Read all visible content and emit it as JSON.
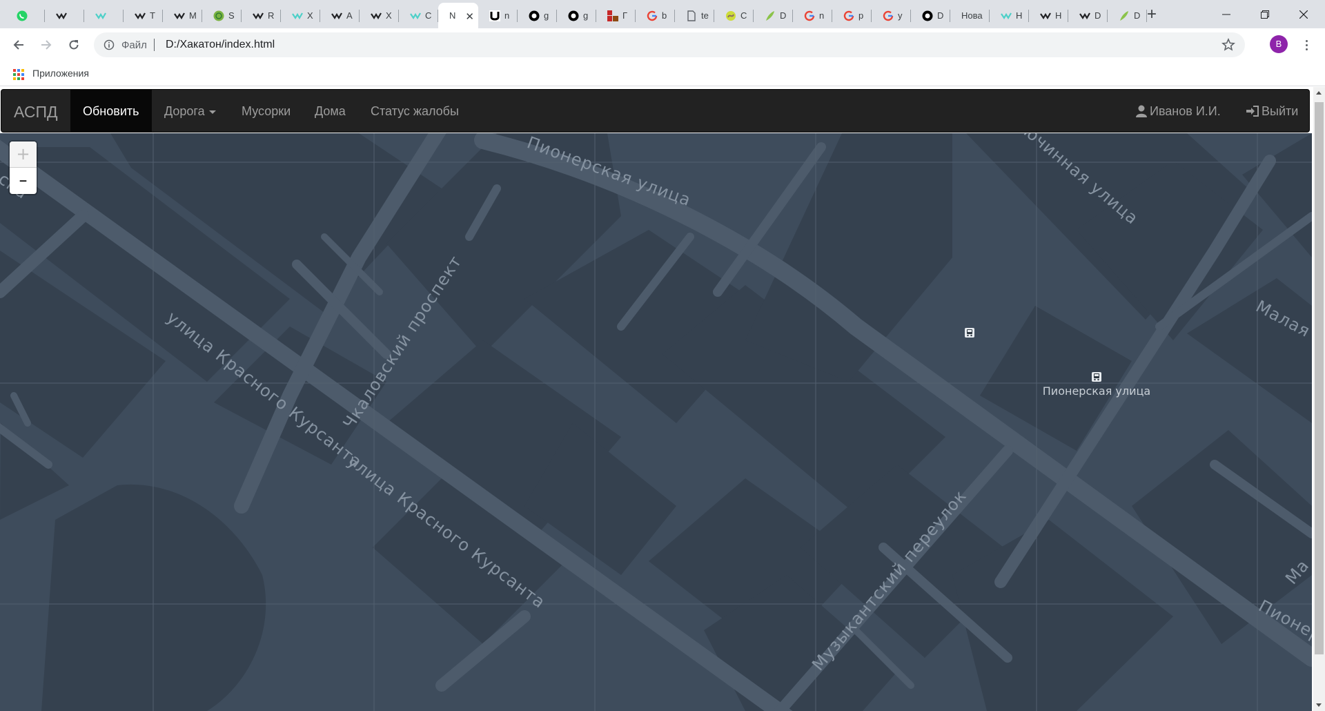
{
  "browser": {
    "tabs": [
      {
        "favicon": "whatsapp-icon",
        "title": "",
        "color": "#25d366"
      },
      {
        "favicon": "bird-logo-icon",
        "title": "",
        "color": "#202124"
      },
      {
        "favicon": "bird-logo-icon",
        "title": "",
        "color": "#4dd0c8"
      },
      {
        "favicon": "bird-logo-icon",
        "title": "T",
        "color": "#202124"
      },
      {
        "favicon": "bird-logo-icon",
        "title": "M",
        "color": "#202124"
      },
      {
        "favicon": "globe-icon",
        "title": "S",
        "color": "#7cb342"
      },
      {
        "favicon": "bird-logo-icon",
        "title": "R",
        "color": "#202124"
      },
      {
        "favicon": "bird-logo-icon",
        "title": "X",
        "color": "#4dd0c8"
      },
      {
        "favicon": "bird-logo-icon",
        "title": "A",
        "color": "#202124"
      },
      {
        "favicon": "bird-logo-icon",
        "title": "X",
        "color": "#202124"
      },
      {
        "favicon": "bird-logo-icon",
        "title": "C",
        "color": "#4dd0c8"
      },
      {
        "favicon": "",
        "title": "N",
        "color": "#202124",
        "active": true
      },
      {
        "favicon": "unity-icon",
        "title": "n",
        "color": "#000000"
      },
      {
        "favicon": "github-gist-icon",
        "title": "g",
        "color": "#000000"
      },
      {
        "favicon": "github-gist-icon",
        "title": "g",
        "color": "#000000"
      },
      {
        "favicon": "blocks-icon",
        "title": "Г",
        "color": "#c62828"
      },
      {
        "favicon": "google-icon",
        "title": "b",
        "color": "#4285f4"
      },
      {
        "favicon": "document-icon",
        "title": "te",
        "color": "#5f6368"
      },
      {
        "favicon": "snake-icon",
        "title": "C",
        "color": "#8d6e63"
      },
      {
        "favicon": "feather-icon",
        "title": "D",
        "color": "#8bc34a"
      },
      {
        "favicon": "google-icon",
        "title": "n",
        "color": "#4285f4"
      },
      {
        "favicon": "google-icon",
        "title": "p",
        "color": "#4285f4"
      },
      {
        "favicon": "google-icon",
        "title": "y",
        "color": "#4285f4"
      },
      {
        "favicon": "github-icon",
        "title": "D",
        "color": "#000000"
      },
      {
        "favicon": "",
        "title": "Нова",
        "color": "#202124"
      },
      {
        "favicon": "bird-logo-icon",
        "title": "H",
        "color": "#4dd0c8"
      },
      {
        "favicon": "bird-logo-icon",
        "title": "H",
        "color": "#202124"
      },
      {
        "favicon": "bird-logo-icon",
        "title": "D",
        "color": "#202124"
      },
      {
        "favicon": "feather-icon",
        "title": "D",
        "color": "#8bc34a"
      }
    ],
    "new_tab": "+",
    "address": {
      "scheme_label": "Файл",
      "url": "D:/Хакатон/index.html"
    },
    "profile_initial": "В",
    "bookmarks": {
      "apps_label": "Приложения"
    }
  },
  "navbar": {
    "brand": "АСПД",
    "items": [
      {
        "label": "Обновить",
        "active": true
      },
      {
        "label": "Дорога",
        "dropdown": true
      },
      {
        "label": "Мусорки"
      },
      {
        "label": "Дома"
      },
      {
        "label": "Статус жалобы"
      }
    ],
    "user": "Иванов И.И.",
    "logout": "Выйти"
  },
  "map": {
    "zoom_in": "+",
    "zoom_out": "–",
    "streets": [
      "Пионерская улица",
      "Чкаловский проспект",
      "улица Красного Курсанта",
      "улица Красного Курсанта",
      "Музыкантский переулок",
      "ючинная улица",
      "Малая Ра",
      "Пионер",
      "Ма",
      "ска"
    ],
    "bus_stop_label": "Пионерская улица",
    "colors": {
      "background": "#3e4c5c",
      "blocks": "#35414f",
      "roads": "#4d5b6b",
      "labels": "#8592a0"
    }
  }
}
